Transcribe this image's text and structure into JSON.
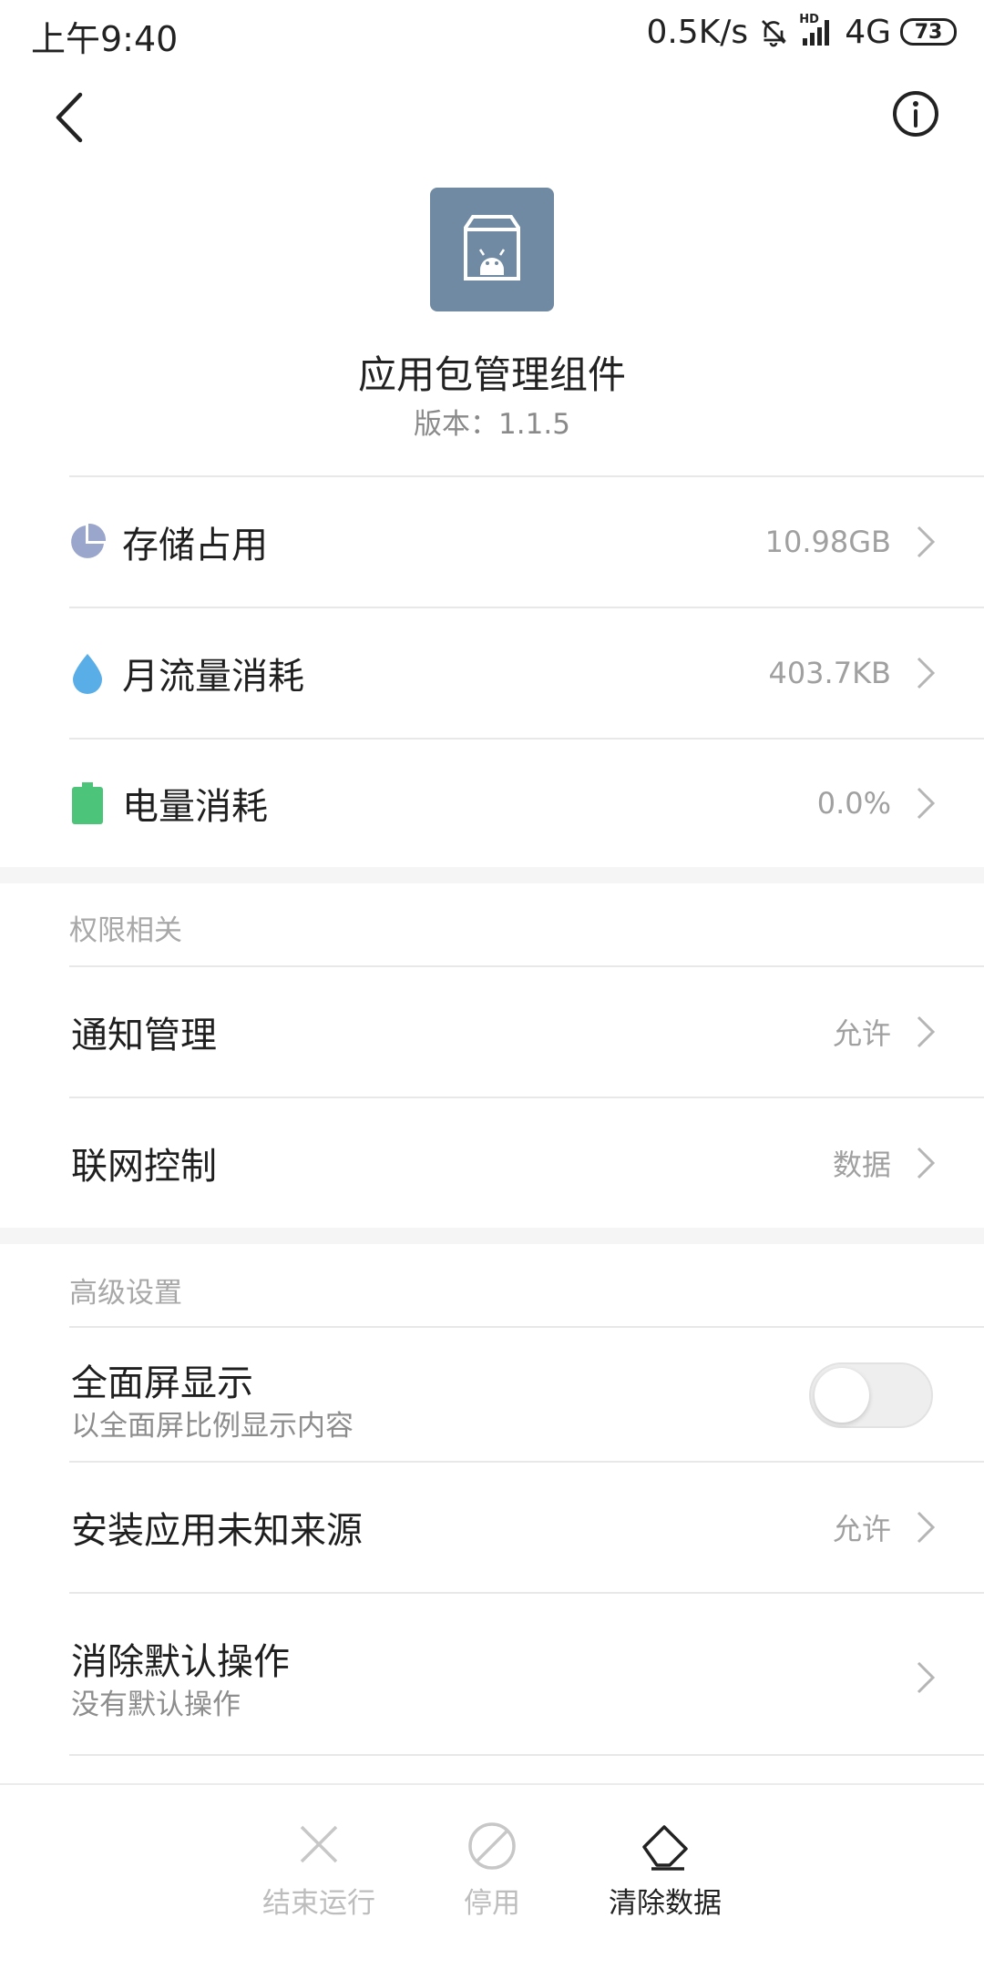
{
  "status_bar": {
    "time": "上午9:40",
    "net_speed": "0.5K/s",
    "hd": "HD",
    "network": "4G",
    "battery": "73",
    "icons": [
      "mute-bell-icon",
      "signal-icon",
      "battery-icon"
    ]
  },
  "header": {
    "back_icon": "chevron-left-icon",
    "info_icon": "info-circle-icon"
  },
  "app": {
    "name": "应用包管理组件",
    "version": "版本：1.1.5",
    "icon": "android-package-icon",
    "icon_color": "#6f8aa2"
  },
  "usage": [
    {
      "label": "存储占用",
      "value": "10.98GB",
      "icon": "pie-chart-icon",
      "color": "#9aa6cc"
    },
    {
      "label": "月流量消耗",
      "value": "403.7KB",
      "icon": "water-drop-icon",
      "color": "#5aaee8"
    },
    {
      "label": "电量消耗",
      "value": "0.0%",
      "icon": "battery-full-icon",
      "color": "#4cc47a"
    }
  ],
  "permissions": {
    "header": "权限相关",
    "items": [
      {
        "label": "通知管理",
        "value": "允许"
      },
      {
        "label": "联网控制",
        "value": "数据"
      }
    ]
  },
  "advanced": {
    "header": "高级设置",
    "fullscreen": {
      "label": "全面屏显示",
      "sub": "以全面屏比例显示内容",
      "enabled": false
    },
    "unknown_sources": {
      "label": "安装应用未知来源",
      "value": "允许"
    },
    "clear_defaults": {
      "label": "消除默认操作",
      "sub": "没有默认操作"
    }
  },
  "bottom_bar": {
    "force_stop": {
      "label": "结束运行",
      "icon": "close-x-icon",
      "enabled": false
    },
    "disable": {
      "label": "停用",
      "icon": "block-icon",
      "enabled": false
    },
    "clear_data": {
      "label": "清除数据",
      "icon": "eraser-icon",
      "enabled": true
    }
  }
}
